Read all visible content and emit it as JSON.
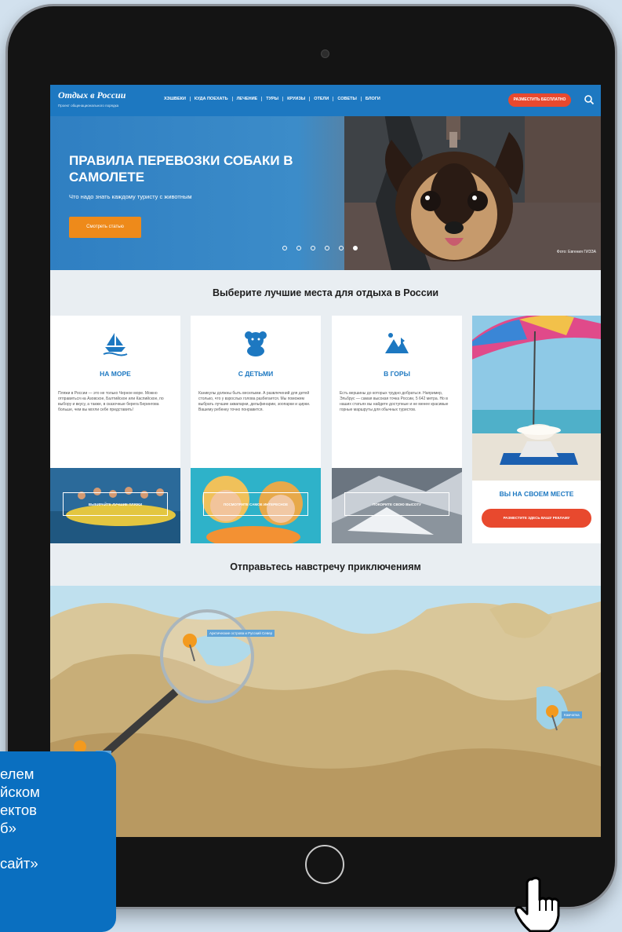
{
  "site": {
    "logo": "Отдых в России",
    "logo_sub": "Проект общенационального порядка",
    "menu": [
      "ХЭШВЕКИ",
      "КУДА ПОЕХАТЬ",
      "ЛЕЧЕНИЕ",
      "ТУРЫ",
      "КРУИЗЫ",
      "ОТЕЛИ",
      "СОВЕТЫ",
      "БЛОГИ"
    ],
    "ad_button": "РАЗМЕСТИТЬ БЕСПЛАТНО",
    "search_icon": "search-icon"
  },
  "hero": {
    "title": "ПРАВИЛА ПЕРЕВОЗКИ СОБАКИ В САМОЛЕТЕ",
    "subtitle": "Что надо знать каждому туристу с животным",
    "button": "Смотреть статью",
    "credit": "Фото: Евгения ГИЗЗА",
    "slides": 6,
    "active_slide": 6
  },
  "places": {
    "title": "Выберите лучшие места для отдыха в России",
    "cards": [
      {
        "icon": "boat-icon",
        "title": "НА МОРЕ",
        "text": "Пляжи в России — это не только Черное море. Можно отправиться на Азовское, Балтийское или Каспийское, по выбору и вкусу, а также, в сказочные берега Берингова больше, чем вы могли себе представить!",
        "button": "ВЫБИРАЙТЕ ЛУЧШИЕ ПЛЯЖИ"
      },
      {
        "icon": "teddy-bear-icon",
        "title": "С ДЕТЬМИ",
        "text": "Каникулы должны быть веселыми. А развлечений для детей столько, что у взрослых голова разбегается. Мы поможем выбрать лучшие аквапарки, дельфинарии, зоопарки и цирки. Вашему ребенку точно понравится.",
        "button": "ПОСМОТРИТЕ САМОЕ ИНТЕРЕСНОЕ"
      },
      {
        "icon": "mountain-icon",
        "title": "В ГОРЫ",
        "text": "Есть вершины до которых трудно добраться. Например, Эльбрус — самая высокая точка России, 5 642 метра. Но в наших статьях вы найдете доступные и не менее красивые горные маршруты для обычных туристов.",
        "button": "ПОКОРИТЕ СВОЮ ВЫСОТУ"
      }
    ],
    "promo": {
      "title": "ВЫ НА СВОЕМ МЕСТЕ",
      "button": "РАЗМЕСТИТЕ ЗДЕСЬ ВАШУ РЕКЛАМУ"
    }
  },
  "adventures": {
    "title": "Отправьтесь навстречу приключениям",
    "labels": [
      "Арктические острова и Русский Север",
      "Камчатка",
      "Кавказ"
    ]
  },
  "callout": {
    "lines": [
      "елем",
      "йском",
      "ектов",
      "б»",
      "",
      "сайт»"
    ]
  },
  "colors": {
    "brand": "#1d78c1",
    "accent": "#e8492e",
    "orange": "#ee8a1a",
    "callout": "#0a6fc0"
  }
}
